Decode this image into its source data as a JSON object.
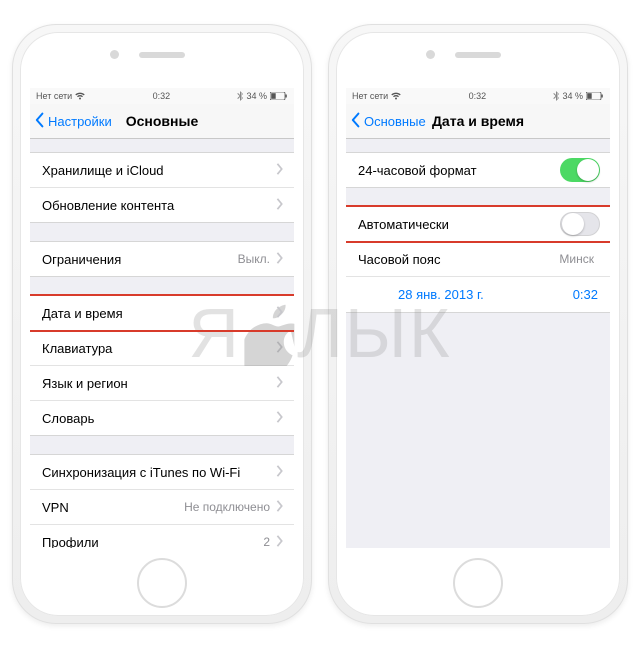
{
  "status": {
    "carrier": "Нет сети",
    "time": "0:32",
    "battery": "34 %"
  },
  "left": {
    "back": "Настройки",
    "title": "Основные",
    "g1": {
      "storage": "Хранилище и iCloud",
      "refresh": "Обновление контента"
    },
    "g2": {
      "restrict": "Ограничения",
      "restrict_val": "Выкл."
    },
    "g3": {
      "datetime": "Дата и время",
      "keyboard": "Клавиатура",
      "lang": "Язык и регион",
      "dict": "Словарь"
    },
    "g4": {
      "itunes": "Синхронизация с iTunes по Wi-Fi",
      "vpn": "VPN",
      "vpn_val": "Не подключено",
      "profiles": "Профили",
      "profiles_val": "2"
    }
  },
  "right": {
    "back": "Основные",
    "title": "Дата и время",
    "r24h": "24-часовой формат",
    "auto": "Автоматически",
    "tz": "Часовой пояс",
    "tz_val": "Минск",
    "date": "28 янв. 2013 г.",
    "time": "0:32"
  },
  "watermark": {
    "a": "Я",
    "b": "ЛЫК"
  }
}
